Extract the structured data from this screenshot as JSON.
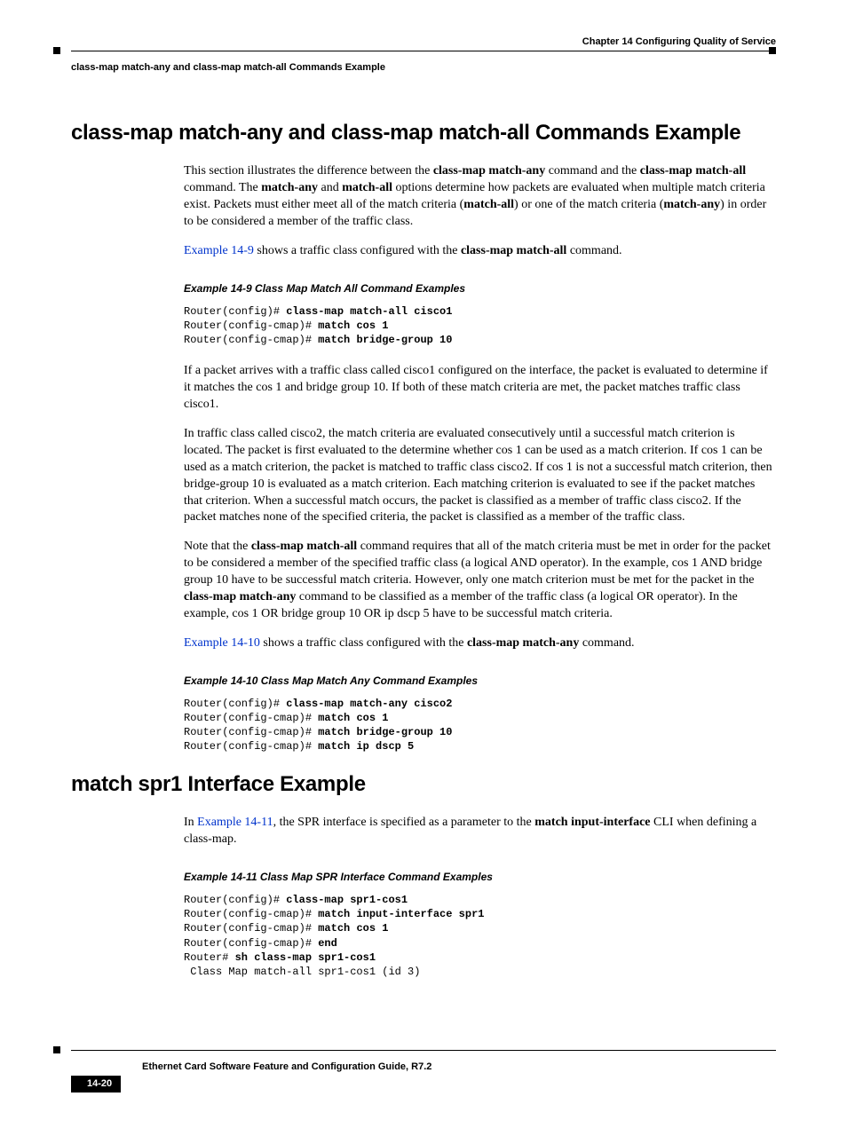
{
  "header": {
    "chapter": "Chapter 14   Configuring Quality of Service",
    "section": "class-map match-any and class-map match-all Commands Example"
  },
  "h1_1": "class-map match-any and class-map match-all Commands Example",
  "p1_a": "This section illustrates the difference between the ",
  "p1_b": "class-map match-any",
  "p1_c": " command and the ",
  "p1_d": "class-map match-all",
  "p1_e": " command. The ",
  "p1_f": "match-any",
  "p1_g": " and ",
  "p1_h": "match-all",
  "p1_i": " options determine how packets are evaluated when multiple match criteria exist. Packets must either meet all of the match criteria (",
  "p1_j": "match-all",
  "p1_k": ") or one of the match criteria (",
  "p1_l": "match-any",
  "p1_m": ") in order to be considered a member of the traffic class.",
  "p2_a": "Example 14-9",
  "p2_b": " shows a traffic class configured with the ",
  "p2_c": "class-map match-all",
  "p2_d": " command.",
  "ex9_title": "Example 14-9   Class Map Match All Command Examples",
  "ex9_l1a": "Router(config)# ",
  "ex9_l1b": "class-map match-all cisco1",
  "ex9_l2a": "Router(config-cmap)# ",
  "ex9_l2b": "match cos 1",
  "ex9_l3a": "Router(config-cmap)# ",
  "ex9_l3b": "match bridge-group 10",
  "p3": "If a packet arrives with a traffic class called cisco1 configured on the interface, the packet is evaluated to determine if it matches the cos 1 and bridge group 10. If both of these match criteria are met, the packet matches traffic class cisco1.",
  "p4": "In traffic class called cisco2, the match criteria are evaluated consecutively until a successful match criterion is located. The packet is first evaluated to the determine whether cos 1 can be used as a match criterion. If cos 1 can be used as a match criterion, the packet is matched to traffic class cisco2. If cos 1 is not a successful match criterion, then bridge-group 10 is evaluated as a match criterion. Each matching criterion is evaluated to see if the packet matches that criterion. When a successful match occurs, the packet is classified as a member of traffic class cisco2. If the packet matches none of the specified criteria, the packet is classified as a member of the traffic class.",
  "p5_a": "Note that the ",
  "p5_b": "class-map match-all",
  "p5_c": " command requires that all of the match criteria must be met in order for the packet to be considered a member of the specified traffic class (a logical AND operator). In the example, cos 1 AND bridge group 10 have to be successful match criteria. However, only one match criterion must be met for the packet in the ",
  "p5_d": "class-map match-any",
  "p5_e": " command to be classified as a member of the traffic class (a logical OR operator). In the example, cos 1 OR bridge group 10 OR ip dscp 5 have to be successful match criteria.",
  "p6_a": "Example 14-10",
  "p6_b": " shows a traffic class configured with the ",
  "p6_c": "class-map match-any",
  "p6_d": " command.",
  "ex10_title": "Example 14-10 Class Map Match Any Command Examples",
  "ex10_l1a": "Router(config)# ",
  "ex10_l1b": "class-map match-any cisco2",
  "ex10_l2a": "Router(config-cmap)# ",
  "ex10_l2b": "match cos 1",
  "ex10_l3a": "Router(config-cmap)# ",
  "ex10_l3b": "match bridge-group 10",
  "ex10_l4a": "Router(config-cmap)# ",
  "ex10_l4b": "match ip dscp 5",
  "h1_2": "match spr1 Interface Example",
  "p7_a": "In ",
  "p7_b": "Example 14-11",
  "p7_c": ", the SPR interface is specified as a parameter to the ",
  "p7_d": "match input-interface",
  "p7_e": " CLI when defining a class-map.",
  "ex11_title": "Example 14-11 Class Map SPR Interface Command Examples",
  "ex11_l1a": "Router(config)# ",
  "ex11_l1b": "class-map spr1-cos1",
  "ex11_l2a": "Router(config-cmap)# ",
  "ex11_l2b": "match input-interface spr1",
  "ex11_l3a": "Router(config-cmap)# ",
  "ex11_l3b": "match cos 1",
  "ex11_l4a": "Router(config-cmap)# ",
  "ex11_l4b": "end",
  "ex11_l5a": "Router# ",
  "ex11_l5b": "sh class-map spr1-cos1",
  "ex11_l6": " Class Map match-all spr1-cos1 (id 3)",
  "footer": {
    "title": "Ethernet Card Software Feature and Configuration Guide, R7.2",
    "page": "14-20"
  }
}
